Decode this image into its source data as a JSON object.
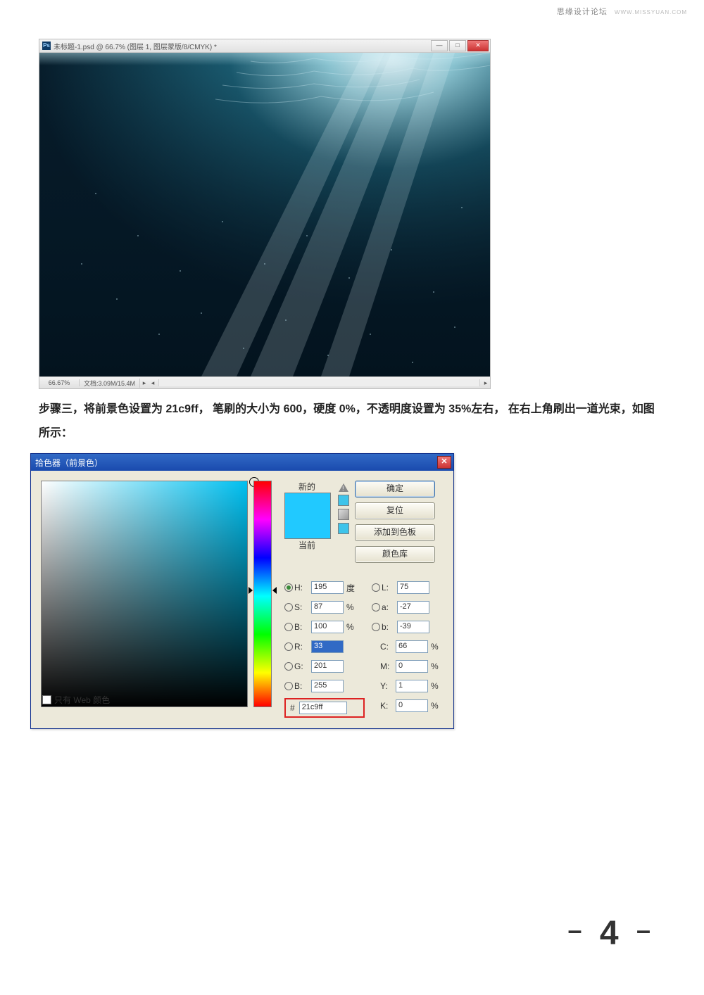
{
  "watermark": {
    "text1": "思缘设计论坛",
    "text2": "WWW.MISSYUAN.COM"
  },
  "ps_window": {
    "title": "未标题-1.psd @ 66.7% (图层 1, 图层蒙版/8/CMYK) *",
    "zoom": "66.67%",
    "docinfo": "文档:3.09M/15.4M"
  },
  "body_text": "步骤三，将前景色设置为 21c9ff，  笔刷的大小为 600，硬度 0%，不透明度设置为 35%左右，  在右上角刷出一道光束，如图所示：",
  "dialog": {
    "title": "拾色器（前景色）",
    "new_label": "新的",
    "current_label": "当前",
    "buttons": {
      "ok": "确定",
      "reset": "复位",
      "add": "添加到色板",
      "lib": "颜色库"
    },
    "labels": {
      "H": "H:",
      "S": "S:",
      "B": "B:",
      "R": "R:",
      "G": "G:",
      "Bc": "B:",
      "L": "L:",
      "a": "a:",
      "b": "b:",
      "C": "C:",
      "M": "M:",
      "Y": "Y:",
      "K": "K:",
      "deg": "度",
      "pct": "%",
      "hash": "#"
    },
    "values": {
      "H": "195",
      "S": "87",
      "Bv": "100",
      "R": "33",
      "G": "201",
      "Bc": "255",
      "L": "75",
      "a": "-27",
      "b": "-39",
      "C": "66",
      "M": "0",
      "Y": "1",
      "K": "0",
      "hex": "21c9ff"
    },
    "webonly": "只有 Web 颜色"
  },
  "page_number": "4"
}
